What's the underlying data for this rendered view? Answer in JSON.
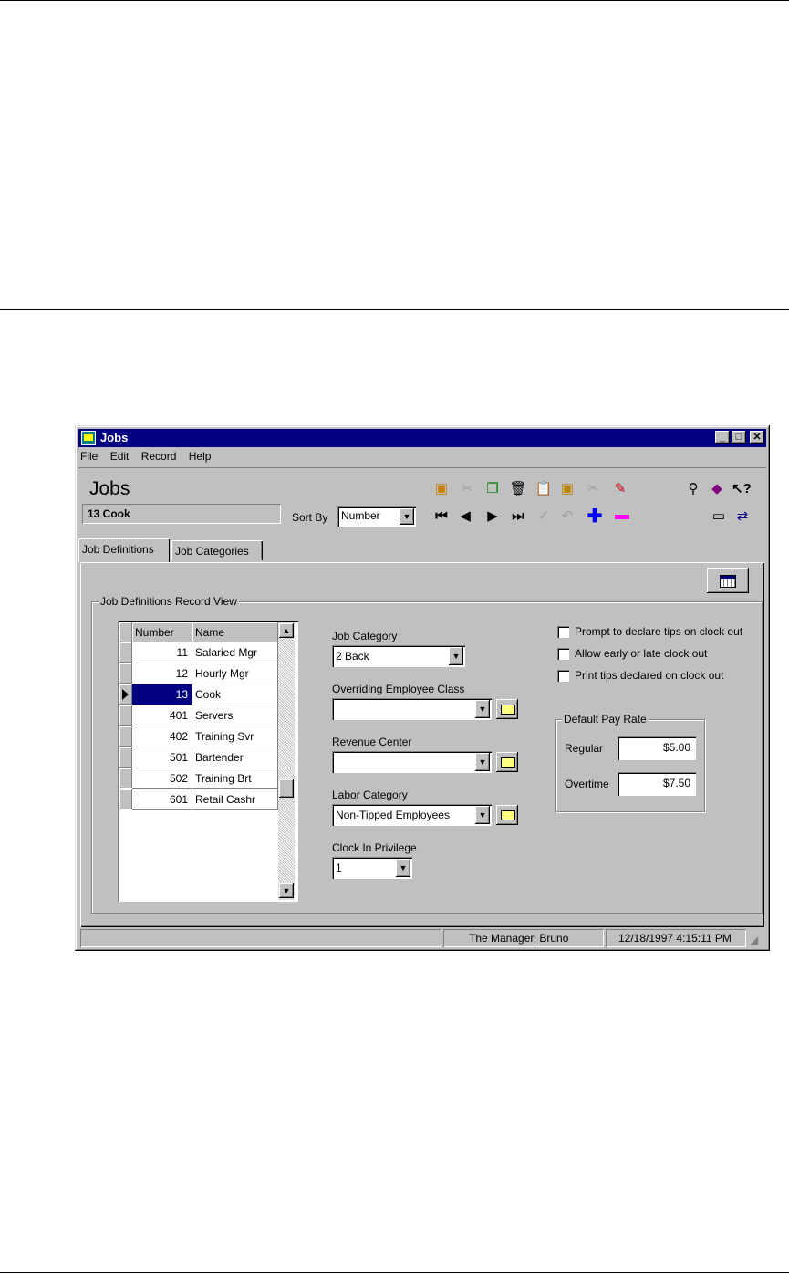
{
  "window": {
    "title": "Jobs"
  },
  "menu": [
    "File",
    "Edit",
    "Record",
    "Help"
  ],
  "header": {
    "title": "Jobs",
    "current_record": "13 Cook"
  },
  "sort": {
    "label": "Sort By",
    "value": "Number"
  },
  "tabs": [
    {
      "label": "Job Definitions",
      "active": true
    },
    {
      "label": "Job Categories",
      "active": false
    }
  ],
  "record_view": {
    "group_label": "Job Definitions Record View",
    "columns": [
      "Number",
      "Name"
    ],
    "rows": [
      {
        "number": "11",
        "name": "Salaried Mgr"
      },
      {
        "number": "12",
        "name": "Hourly Mgr"
      },
      {
        "number": "13",
        "name": "Cook",
        "selected": true
      },
      {
        "number": "401",
        "name": "Servers"
      },
      {
        "number": "402",
        "name": "Training Svr"
      },
      {
        "number": "501",
        "name": "Bartender"
      },
      {
        "number": "502",
        "name": "Training Brt"
      },
      {
        "number": "601",
        "name": "Retail Cashr"
      }
    ]
  },
  "form": {
    "job_category": {
      "label": "Job Category",
      "value": "2  Back"
    },
    "overriding_class": {
      "label": "Overriding Employee Class",
      "value": ""
    },
    "revenue_center": {
      "label": "Revenue Center",
      "value": ""
    },
    "labor_category": {
      "label": "Labor Category",
      "value": "Non-Tipped Employees"
    },
    "clock_in_privilege": {
      "label": "Clock In Privilege",
      "value": "1"
    }
  },
  "options": [
    {
      "label": "Prompt to declare tips on clock out",
      "checked": false
    },
    {
      "label": "Allow early or late clock out",
      "checked": false
    },
    {
      "label": "Print tips declared on clock out",
      "checked": false
    }
  ],
  "pay_rate": {
    "group_label": "Default Pay Rate",
    "regular_label": "Regular",
    "regular": "$5.00",
    "overtime_label": "Overtime",
    "overtime": "$7.50"
  },
  "statusbar": {
    "left": "",
    "user": "The Manager, Bruno",
    "datetime": "12/18/1997 4:15:11 PM"
  },
  "colors": {
    "titlebar": "#000080",
    "face": "#c0c0c0",
    "selection": "#000080"
  }
}
